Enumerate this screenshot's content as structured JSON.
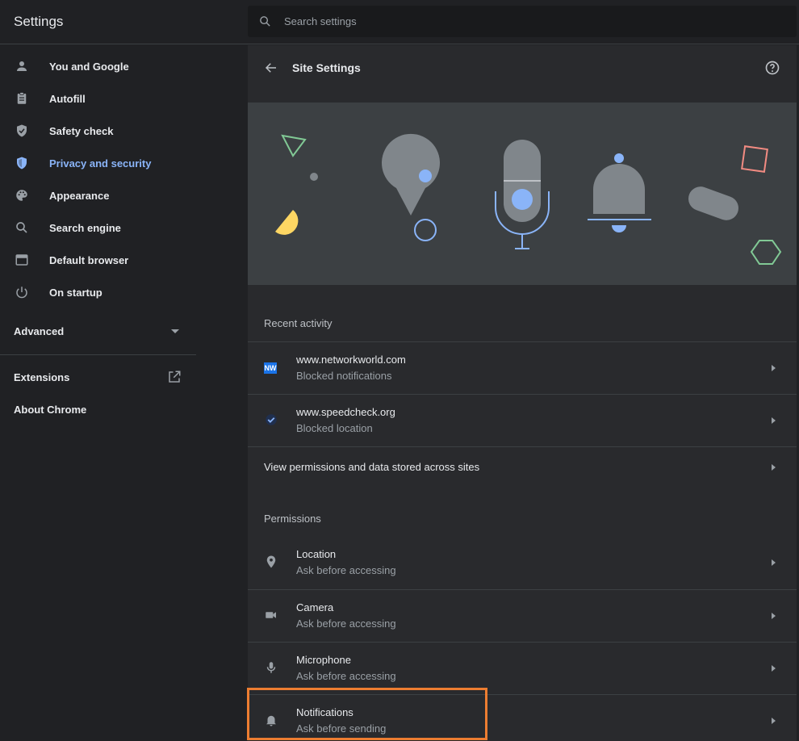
{
  "app": {
    "title": "Settings"
  },
  "search": {
    "placeholder": "Search settings"
  },
  "sidebar": {
    "items": [
      {
        "label": "You and Google",
        "icon": "person-icon"
      },
      {
        "label": "Autofill",
        "icon": "clipboard-icon"
      },
      {
        "label": "Safety check",
        "icon": "shield-check-icon"
      },
      {
        "label": "Privacy and security",
        "icon": "shield-icon",
        "active": true
      },
      {
        "label": "Appearance",
        "icon": "palette-icon"
      },
      {
        "label": "Search engine",
        "icon": "search-icon"
      },
      {
        "label": "Default browser",
        "icon": "browser-icon"
      },
      {
        "label": "On startup",
        "icon": "power-icon"
      }
    ],
    "advanced": "Advanced",
    "extensions": "Extensions",
    "about": "About Chrome"
  },
  "main": {
    "title": "Site Settings",
    "recent_activity": {
      "title": "Recent activity",
      "items": [
        {
          "site": "www.networkworld.com",
          "status": "Blocked notifications",
          "icon": "networkworld-favicon",
          "favicon_text": "NW"
        },
        {
          "site": "www.speedcheck.org",
          "status": "Blocked location",
          "icon": "speedcheck-favicon"
        }
      ],
      "view_all": "View permissions and data stored across sites"
    },
    "permissions": {
      "title": "Permissions",
      "items": [
        {
          "name": "Location",
          "status": "Ask before accessing",
          "icon": "location-pin-icon"
        },
        {
          "name": "Camera",
          "status": "Ask before accessing",
          "icon": "camera-icon"
        },
        {
          "name": "Microphone",
          "status": "Ask before accessing",
          "icon": "microphone-icon"
        },
        {
          "name": "Notifications",
          "status": "Ask before sending",
          "icon": "bell-icon"
        }
      ]
    }
  },
  "colors": {
    "background": "#202124",
    "panel": "#292a2d",
    "accent": "#8ab4f8",
    "highlight": "#ed7d31"
  }
}
